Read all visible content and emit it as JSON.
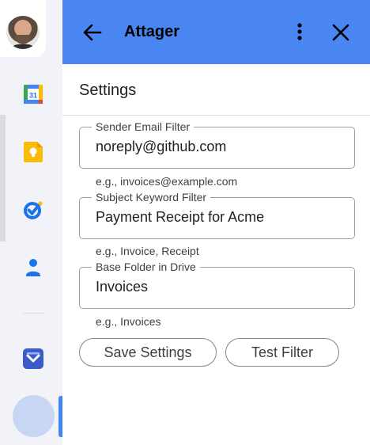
{
  "header": {
    "title": "Attager",
    "back_icon": "arrow-back-icon",
    "more_icon": "more-vert-icon",
    "close_icon": "close-icon",
    "color": "#4a86f2"
  },
  "settings": {
    "title": "Settings",
    "sender": {
      "label": "Sender Email Filter",
      "value": "noreply@github.com",
      "hint": "e.g., invoices@example.com"
    },
    "subject": {
      "label": "Subject Keyword Filter",
      "value": "Payment Receipt for Acme",
      "hint": "e.g., Invoice, Receipt"
    },
    "folder": {
      "label": "Base Folder in Drive",
      "value": "Invoices",
      "hint": "e.g., Invoices"
    },
    "save_label": "Save Settings",
    "test_label": "Test Filter"
  },
  "rail": {
    "calendar_day": "31",
    "icons": [
      "calendar-icon",
      "keep-icon",
      "tasks-icon",
      "contacts-icon",
      "addon-icon"
    ]
  }
}
